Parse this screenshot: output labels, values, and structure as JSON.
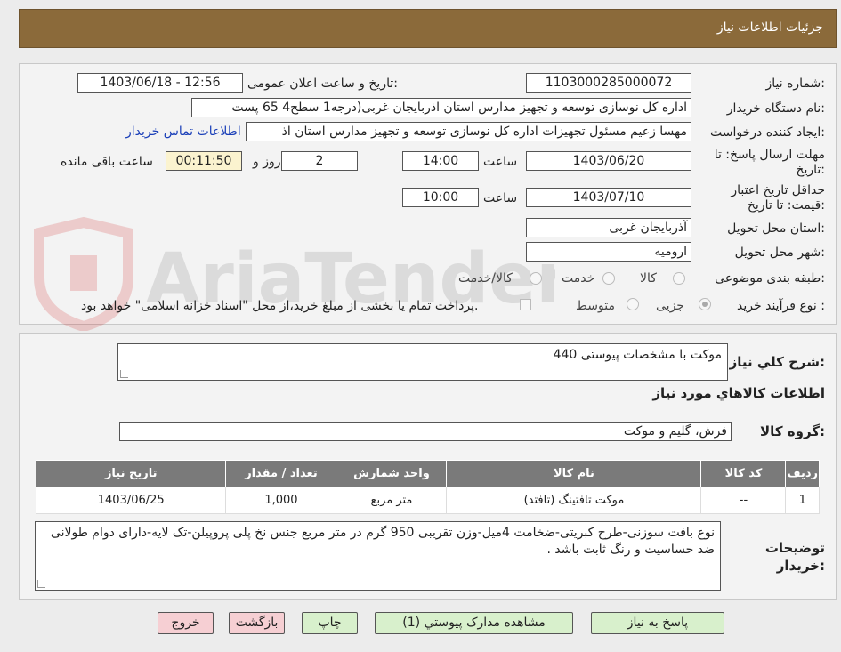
{
  "header": {
    "title": "جزئیات اطلاعات نیاز"
  },
  "watermark": {
    "text": "AriaTender.neT"
  },
  "form": {
    "need_number_label": "شماره نیاز:",
    "need_number": "1103000285000072",
    "announce_label": "تاریخ و ساعت اعلان عمومی:",
    "announce_value": "1403/06/18 - 12:56",
    "buyer_org_label": "نام دستگاه خریدار:",
    "buyer_org": "اداره کل نوسازی   توسعه و تجهیز مدارس استان اذربایجان غربی(درجه1  سطح4  65 پست",
    "requester_label": "ایجاد کننده درخواست:",
    "requester": "مهسا زعیم مسئول تجهیزات اداره کل نوسازی   توسعه و تجهیز مدارس استان اذ",
    "contact_link": "اطلاعات تماس خریدار",
    "reply_deadline_label": "مهلت ارسال پاسخ: تا تاریخ:",
    "reply_date": "1403/06/20",
    "time_label": "ساعت",
    "reply_time": "14:00",
    "days_value": "2",
    "days_label": "روز و",
    "remaining_time": "00:11:50",
    "remaining_label": "ساعت باقی مانده",
    "validity_label": "حداقل تاریخ اعتبار قیمت: تا تاریخ:",
    "validity_date": "1403/07/10",
    "validity_time": "10:00",
    "province_label": "استان محل تحویل:",
    "province": "آذربایجان غربی",
    "city_label": "شهر محل تحویل:",
    "city": "ارومیه",
    "category_label": "طبقه بندی موضوعی:",
    "category_options": [
      "کالا",
      "خدمت",
      "کالا/خدمت"
    ],
    "purchase_type_label": "نوع فرآیند خرید :",
    "purchase_options": [
      "جزیی",
      "متوسط"
    ],
    "payment_note": "پرداخت تمام یا بخشی از مبلغ خرید،از محل \"اسناد خزانه اسلامی\" خواهد بود."
  },
  "summary": {
    "general_desc_label": "شرح کلي نياز:",
    "general_desc": "موکت با مشخصات پیوستی 440",
    "goods_info_title": "اطلاعات کالاهاي مورد نياز",
    "goods_group_label": "گروه کالا:",
    "goods_group": "فرش، گلیم و موکت"
  },
  "table": {
    "headers": [
      "رديف",
      "کد کالا",
      "نام کالا",
      "واحد شمارش",
      "تعداد / مقدار",
      "تاريخ نياز"
    ],
    "rows": [
      {
        "index": "1",
        "code": "--",
        "name": "موکت تافتینگ (تافتد)",
        "unit": "متر مربع",
        "qty": "1,000",
        "date": "1403/06/25"
      }
    ]
  },
  "buyer_notes": {
    "label": "توضيحات خريدار:",
    "text": "نوع بافت سوزنی-طرح کبریتی-ضخامت 4میل-وزن تقریبی 950 گرم در متر مربع جنس نخ پلی پروپیلن-تک لایه-دارای دوام طولانی ضد حساسیت و رنگ ثابت باشد ."
  },
  "buttons": {
    "reply": "پاسخ به نیاز",
    "view_docs": "مشاهده مدارک پیوستي (1)",
    "print": "چاپ",
    "back": "بازگشت",
    "exit": "خروج"
  }
}
